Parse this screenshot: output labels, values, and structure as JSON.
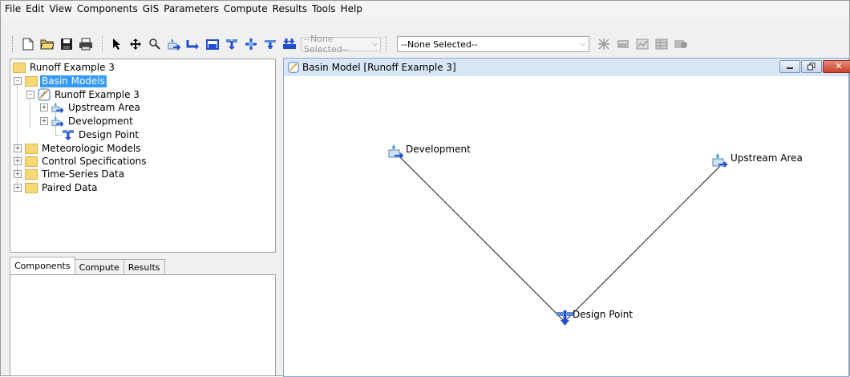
{
  "menu": [
    "File",
    "Edit",
    "View",
    "Components",
    "GIS",
    "Parameters",
    "Compute",
    "Results",
    "Tools",
    "Help"
  ],
  "toolbar": {
    "icons": [
      "new-file-icon",
      "open-folder-icon",
      "save-icon",
      "print-icon",
      "arrow-select-icon",
      "pan-icon",
      "zoom-icon",
      "subbasin-tool-icon",
      "reach-tool-icon",
      "reservoir-tool-icon",
      "junction-tool-icon",
      "diversion-tool-icon",
      "source-tool-icon",
      "sink-tool-icon"
    ],
    "component_select": "--None Selected--",
    "run_select": "--None Selected--"
  },
  "tree": {
    "project": "Runoff Example 3",
    "basin_models": "Basin Models",
    "basin_model": "Runoff Example 3",
    "upstream_area": "Upstream Area",
    "development": "Development",
    "design_point": "Design Point",
    "meteorologic": "Meteorologic Models",
    "control": "Control Specifications",
    "timeseries": "Time-Series Data",
    "paired": "Paired Data"
  },
  "tabs": [
    "Components",
    "Compute",
    "Results"
  ],
  "basin_window": {
    "title": "Basin Model [Runoff Example 3]"
  },
  "map": {
    "development": "Development",
    "upstream_area": "Upstream Area",
    "design_point": "Design Point"
  },
  "colors": {
    "selection": "#3399ff",
    "title_bar": "#d9e6f5",
    "folder": "#f6d874",
    "close_button": "#c9432e"
  }
}
